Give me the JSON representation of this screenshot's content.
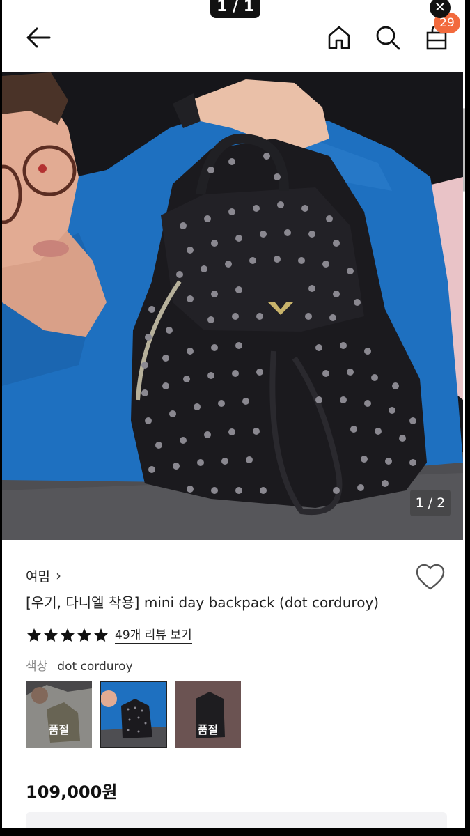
{
  "viewer": {
    "counter": "1 / 1"
  },
  "header": {
    "back_icon": "arrow-left-icon",
    "home_icon": "home-icon",
    "search_icon": "search-icon",
    "cart_icon": "shopping-bag-icon",
    "cart_count": "29"
  },
  "gallery": {
    "counter": "1 / 2"
  },
  "product": {
    "brand": "여밈",
    "brand_chevron": "›",
    "title": "[우기, 다니엘 착용] mini day backpack (dot corduroy)",
    "rating_stars": 5,
    "review_link": "49개 리뷰 보기",
    "color_label": "색상",
    "color_value": "dot corduroy",
    "swatches": [
      {
        "status": "품절"
      },
      {
        "status": ""
      },
      {
        "status": "품절"
      }
    ],
    "price": "109,000원"
  },
  "colors": {
    "accent_badge": "#f26a3d",
    "sweater_blue": "#1e70c0",
    "bag_black": "#1b1a1e"
  }
}
